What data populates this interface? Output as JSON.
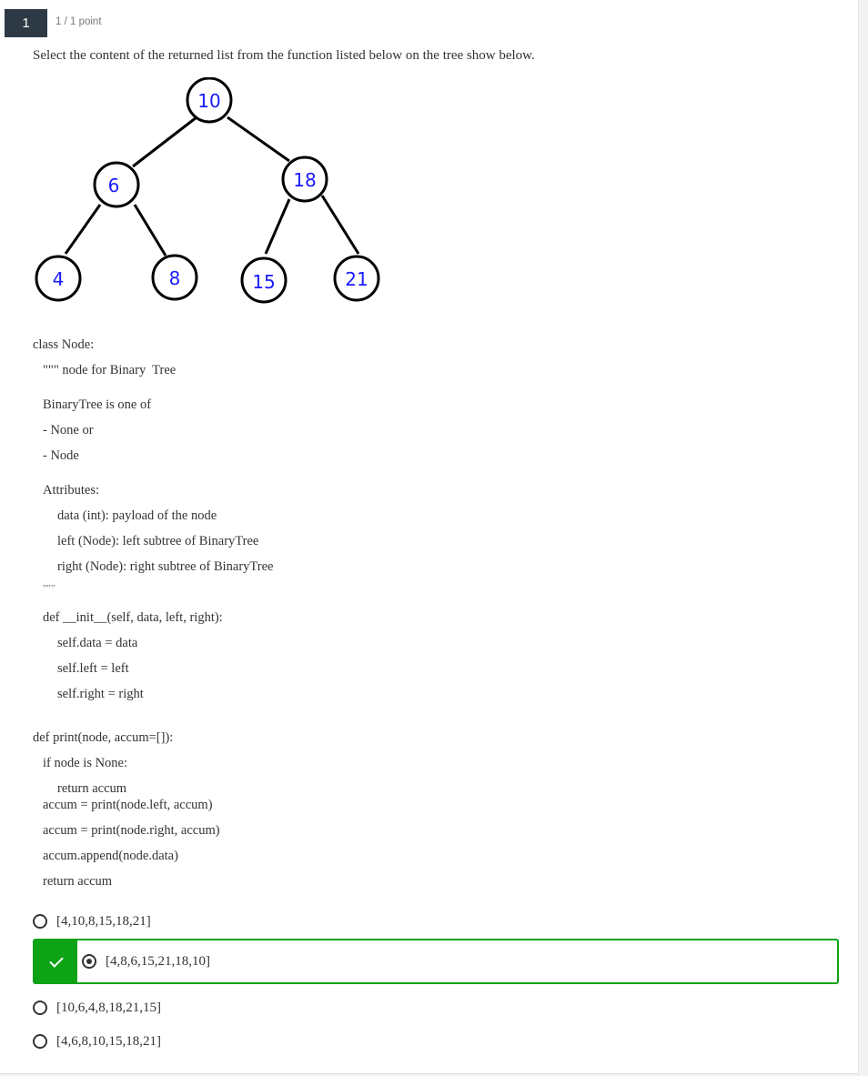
{
  "question": {
    "number": "1",
    "points": "1 / 1 point",
    "prompt": "Select the content of the returned list from the function listed below on the tree show below."
  },
  "tree": {
    "nodes": [
      "10",
      "6",
      "18",
      "4",
      "8",
      "15",
      "21"
    ]
  },
  "code": {
    "lines": [
      "class Node:",
      "\"\"\" node for Binary  Tree",
      "BinaryTree is one of",
      "- None or",
      "- Node",
      "Attributes:",
      "data (int): payload of the node",
      "left (Node): left subtree of BinaryTree",
      "right (Node): right subtree of BinaryTree",
      "\"\"\"",
      "def __init__(self, data, left, right):",
      "self.data = data",
      "self.left = left",
      "self.right = right",
      "def print(node, accum=[]):",
      "if node is None:",
      "return accum",
      "accum = print(node.left, accum)",
      "accum = print(node.right, accum)",
      "accum.append(node.data)",
      "return accum"
    ]
  },
  "options": [
    {
      "label": "[4,10,8,15,18,21]",
      "selected": false
    },
    {
      "label": "[4,8,6,15,21,18,10]",
      "selected": true,
      "correct": true
    },
    {
      "label": "[10,6,4,8,18,21,15]",
      "selected": false
    },
    {
      "label": "[4,6,8,10,15,18,21]",
      "selected": false
    }
  ],
  "colors": {
    "correct": "#0ea315",
    "number_badge": "#2d3a45",
    "node_text": "#1a1aff"
  }
}
